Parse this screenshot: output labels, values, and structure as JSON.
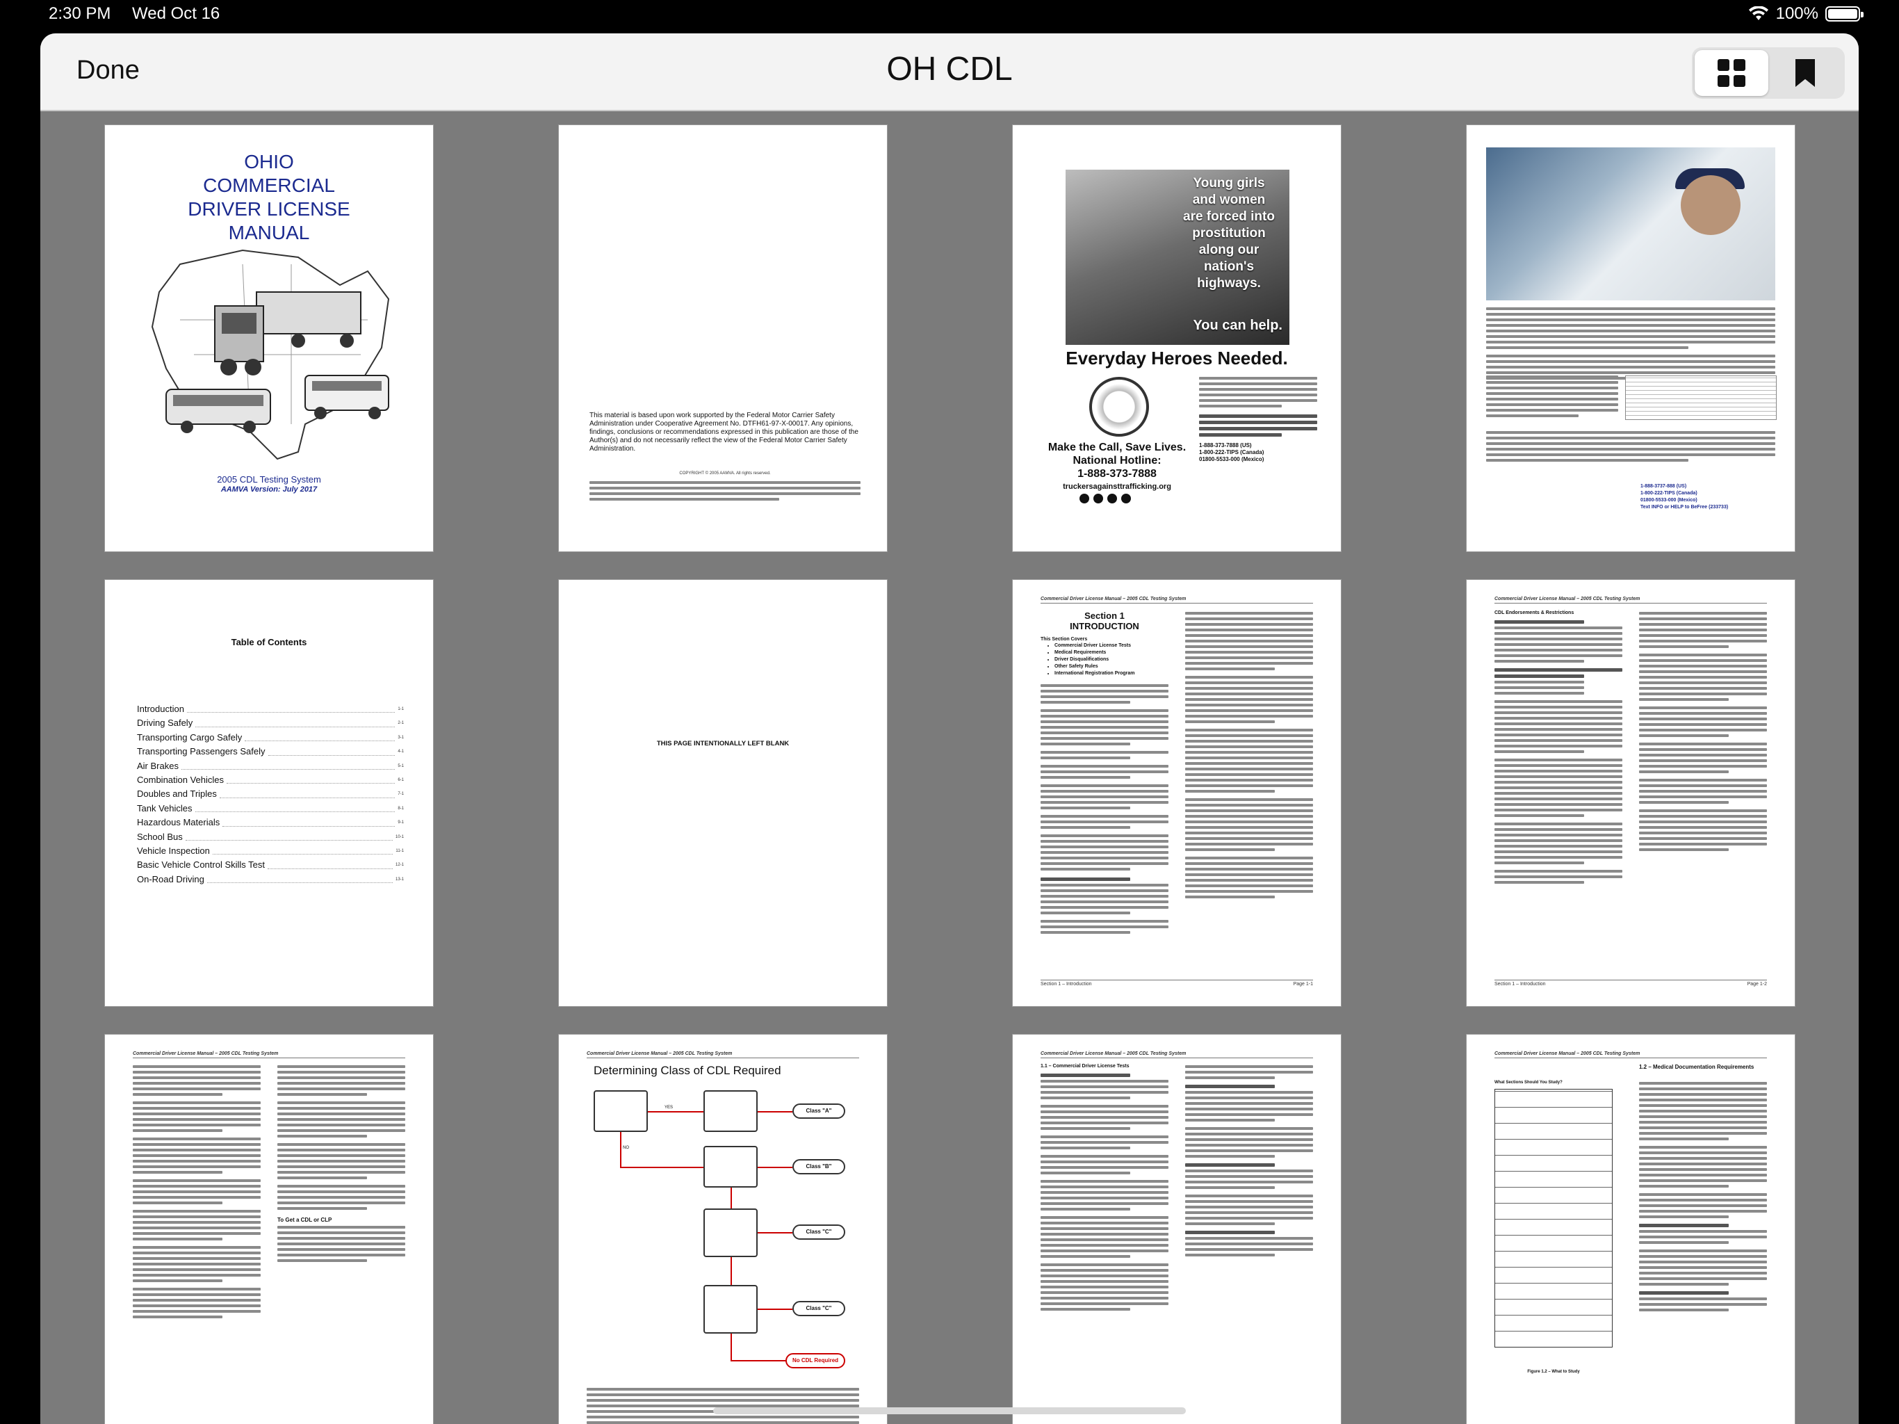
{
  "status_bar": {
    "time": "2:30 PM",
    "date": "Wed Oct 16",
    "battery_label": "100%",
    "battery_level": 1.0,
    "wifi_icon": "wifi-icon",
    "battery_icon": "battery-icon"
  },
  "nav": {
    "done_label": "Done",
    "title": "OH CDL",
    "view_options": [
      "grid-view-icon",
      "bookmark-icon"
    ],
    "selected_view": "grid"
  },
  "pages": {
    "cover": {
      "title_lines": [
        "OHIO",
        "COMMERCIAL",
        "DRIVER LICENSE",
        "MANUAL"
      ],
      "subtitle": "2005 CDL Testing System",
      "version": "AAMVA Version: July 2017"
    },
    "copyright": {
      "notice": "This material is based upon work supported by the Federal Motor Carrier Safety Administration under Cooperative Agreement No. DTFH61-97-X-00017. Any opinions, findings, conclusions or recommendations expressed in this publication are those of the Author(s) and do not necessarily reflect the view of the Federal Motor Carrier Safety Administration.",
      "copy": "COPYRIGHT © 2005 AAMVA. All rights reserved."
    },
    "poster": {
      "headline_lines": [
        "Young girls",
        "and women",
        "are forced into",
        "prostitution",
        "along our",
        "nation's",
        "highways."
      ],
      "help": "You can help.",
      "heroes": "Everyday Heroes Needed.",
      "make_call": "Make the Call, Save Lives.",
      "hotline_label": "National Hotline:",
      "hotline_number": "1-888-373-7888",
      "website": "truckersagainsttrafficking.org",
      "numbers": [
        "1-888-373-7888 (US)",
        "1-800-222-TIPS (Canada)",
        "01800-5533-000 (Mexico)"
      ]
    },
    "truck_story": {
      "numbers": [
        "1-888-3737-888 (US)",
        "1-800-222-TIPS (Canada)",
        "01800-5533-000 (Mexico)",
        "Text INFO or HELP to BeFree (233733)"
      ]
    },
    "toc": {
      "title": "Table of Contents",
      "entries": [
        {
          "label": "Introduction",
          "page": "1-1"
        },
        {
          "label": "Driving Safely",
          "page": "2-1"
        },
        {
          "label": "Transporting Cargo Safely",
          "page": "3-1"
        },
        {
          "label": "Transporting Passengers Safely",
          "page": "4-1"
        },
        {
          "label": "Air Brakes",
          "page": "5-1"
        },
        {
          "label": "Combination Vehicles",
          "page": "6-1"
        },
        {
          "label": "Doubles and Triples",
          "page": "7-1"
        },
        {
          "label": "Tank Vehicles",
          "page": "8-1"
        },
        {
          "label": "Hazardous Materials",
          "page": "9-1"
        },
        {
          "label": "School Bus",
          "page": "10-1"
        },
        {
          "label": "Vehicle Inspection",
          "page": "11-1"
        },
        {
          "label": "Basic Vehicle Control Skills Test",
          "page": "12-1"
        },
        {
          "label": "On-Road Driving",
          "page": "13-1"
        }
      ]
    },
    "blank": {
      "text": "THIS PAGE INTENTIONALLY LEFT BLANK"
    },
    "section1": {
      "header": "Commercial Driver License Manual – 2005 CDL Testing System",
      "title_lines": [
        "Section 1",
        "INTRODUCTION"
      ],
      "covers_heading": "This Section Covers",
      "covers": [
        "Commercial Driver License Tests",
        "Medical Requirements",
        "Driver Disqualifications",
        "Other Safety Rules",
        "International Registration Program"
      ],
      "footer_left": "Section 1 – Introduction",
      "footer_right": "Page 1-1"
    },
    "endorsements": {
      "header": "Commercial Driver License Manual – 2005 CDL Testing System",
      "heading": "CDL Endorsements & Restrictions",
      "footer_left": "Section 1 – Introduction",
      "footer_right": "Page 1-2"
    },
    "restrictions": {
      "header": "Commercial Driver License Manual – 2005 CDL Testing System",
      "heading": "To Get a CDL or CLP"
    },
    "flowchart": {
      "header": "Commercial Driver License Manual – 2005 CDL Testing System",
      "title": "Determining Class of CDL Required",
      "outcomes": [
        "Class \"A\"",
        "Class \"B\"",
        "Class \"C\"",
        "Class \"C\"",
        "No CDL Required"
      ],
      "yes": "YES",
      "no": "NO"
    },
    "tests": {
      "header": "Commercial Driver License Manual – 2005 CDL Testing System",
      "heading": "1.1 – Commercial Driver License Tests"
    },
    "medical": {
      "header": "Commercial Driver License Manual – 2005 CDL Testing System",
      "heading": "1.2 – Medical Documentation Requirements",
      "table_title": "What Sections Should You Study?",
      "figure": "Figure 1.2 – What to Study"
    }
  }
}
